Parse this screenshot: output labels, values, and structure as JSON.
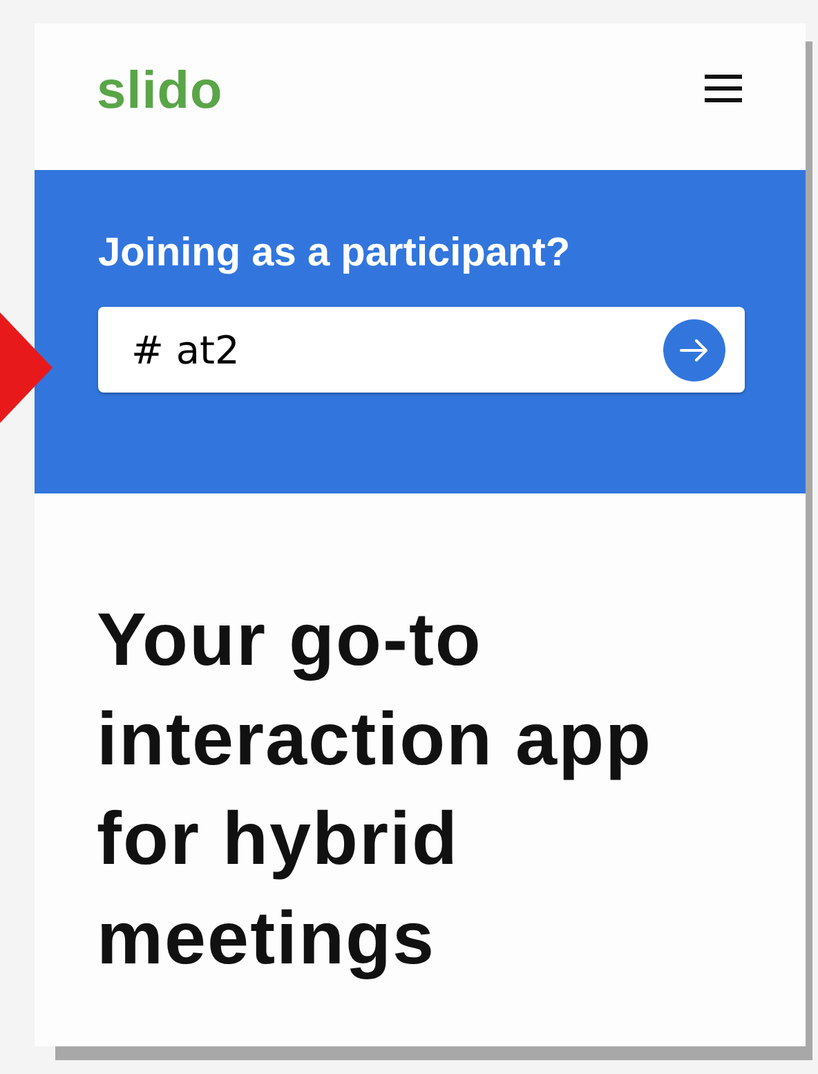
{
  "header": {
    "logo": "slido"
  },
  "join_panel": {
    "title": "Joining as a participant?",
    "code_field": {
      "value": "# at2"
    }
  },
  "hero": {
    "headline": "Your go-to interaction app for hybrid meetings"
  }
}
